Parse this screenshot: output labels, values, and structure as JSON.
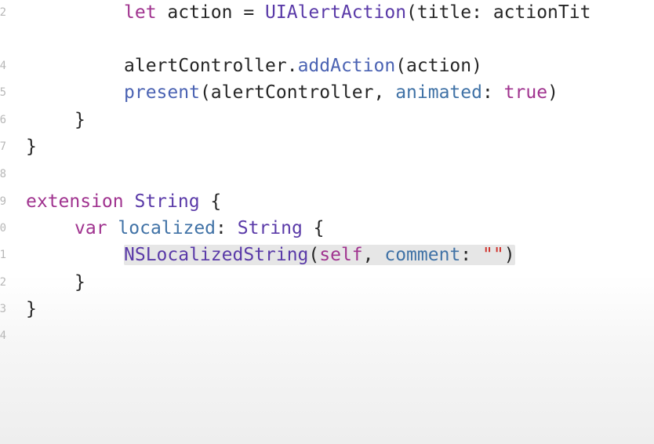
{
  "editor": {
    "gutter_numbers": [
      "2",
      "",
      "4",
      "5",
      "6",
      "7",
      "8",
      "9",
      "0",
      "1",
      "2",
      "3",
      "4"
    ],
    "line1": {
      "let": "let",
      "sp1": " action = ",
      "cls": "UIAlertAction",
      "rest": "(title: actionTit"
    },
    "line2": {
      "obj": "alertController.",
      "method": "addAction",
      "rest": "(action)"
    },
    "line3": {
      "fn": "present",
      "open": "(alertController, ",
      "arg": "animated",
      "colon": ": ",
      "val": "true",
      "close": ")"
    },
    "line4": {
      "brace": "}"
    },
    "line5": {
      "brace": "}"
    },
    "line6": {
      "kw": "extension",
      "sp": " ",
      "type": "String",
      "brace": " {"
    },
    "line7": {
      "kw": "var",
      "sp": " ",
      "prop": "localized",
      "colon": ": ",
      "type": "String",
      "brace": " {"
    },
    "line8": {
      "fn": "NSLocalizedString",
      "open": "(",
      "self": "self",
      "comma": ", ",
      "arg": "comment",
      "colon": ": ",
      "str": "\"\"",
      "close": ")"
    },
    "line9": {
      "brace": "}"
    },
    "line10": {
      "brace": "}"
    }
  }
}
